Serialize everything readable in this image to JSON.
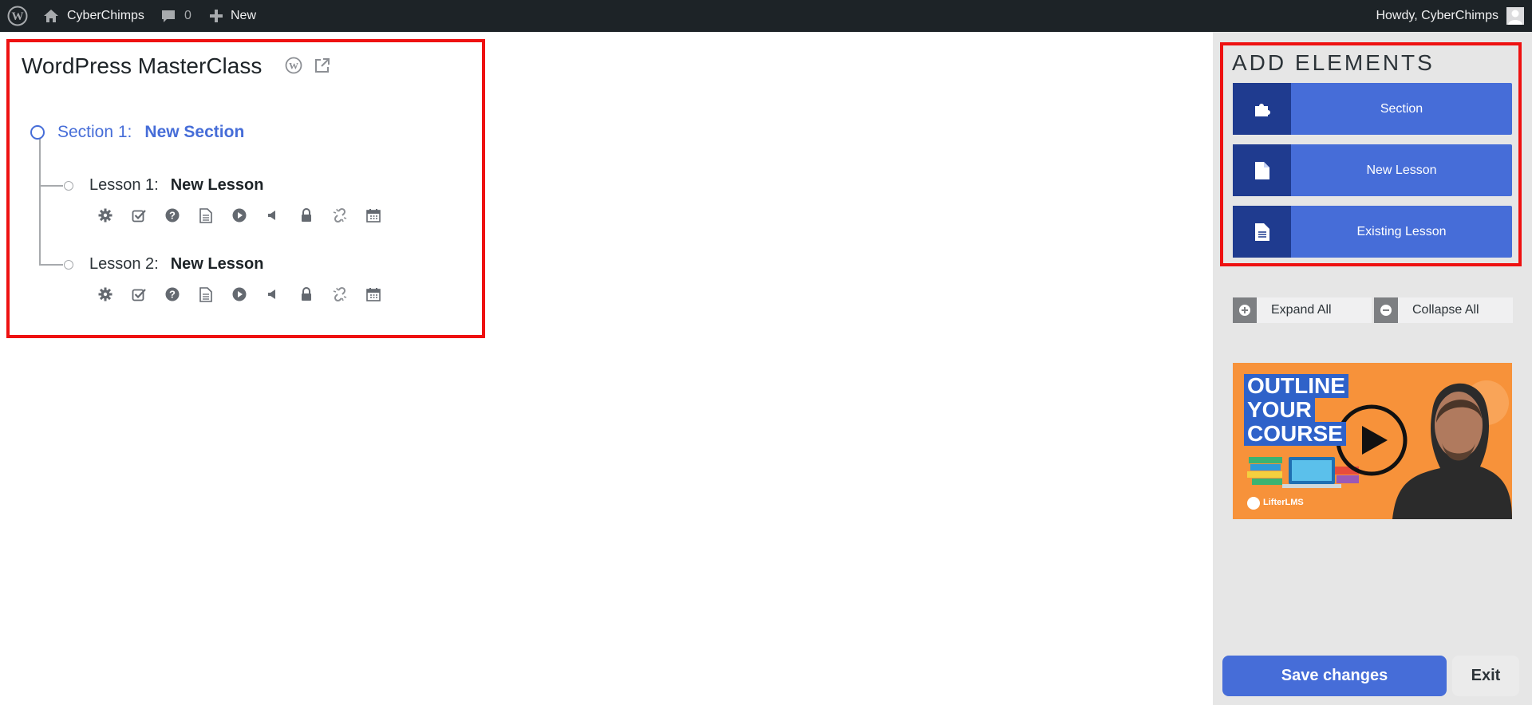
{
  "adminbar": {
    "site_name": "CyberChimps",
    "comments_count": "0",
    "new_label": "New",
    "greeting": "Howdy, CyberChimps"
  },
  "course": {
    "title": "WordPress MasterClass",
    "section": {
      "prefix": "Section 1:",
      "name": "New Section"
    },
    "lessons": [
      {
        "prefix": "Lesson 1:",
        "name": "New Lesson"
      },
      {
        "prefix": "Lesson 2:",
        "name": "New Lesson"
      }
    ],
    "lesson_icon_names": [
      "gear-icon",
      "checkbox-icon",
      "question-icon",
      "document-icon",
      "play-icon",
      "audio-icon",
      "lock-icon",
      "unlink-icon",
      "calendar-icon"
    ]
  },
  "sidebar": {
    "title": "ADD ELEMENTS",
    "buttons": [
      {
        "label": "Section",
        "icon": "puzzle-icon"
      },
      {
        "label": "New Lesson",
        "icon": "file-icon"
      },
      {
        "label": "Existing Lesson",
        "icon": "file-text-icon"
      }
    ],
    "expand_label": "Expand All",
    "collapse_label": "Collapse All",
    "video": {
      "text_lines": [
        "OUTLINE",
        "YOUR",
        "COURSE"
      ],
      "brand": "LifterLMS"
    },
    "save_label": "Save changes",
    "exit_label": "Exit"
  },
  "colors": {
    "accent": "#466dd8",
    "accent_dark": "#1f3b8f",
    "admin_bar": "#1d2327",
    "highlight_border": "#ee1111",
    "sidebar_bg": "#e6e6e6",
    "video_bg": "#f7923a"
  }
}
